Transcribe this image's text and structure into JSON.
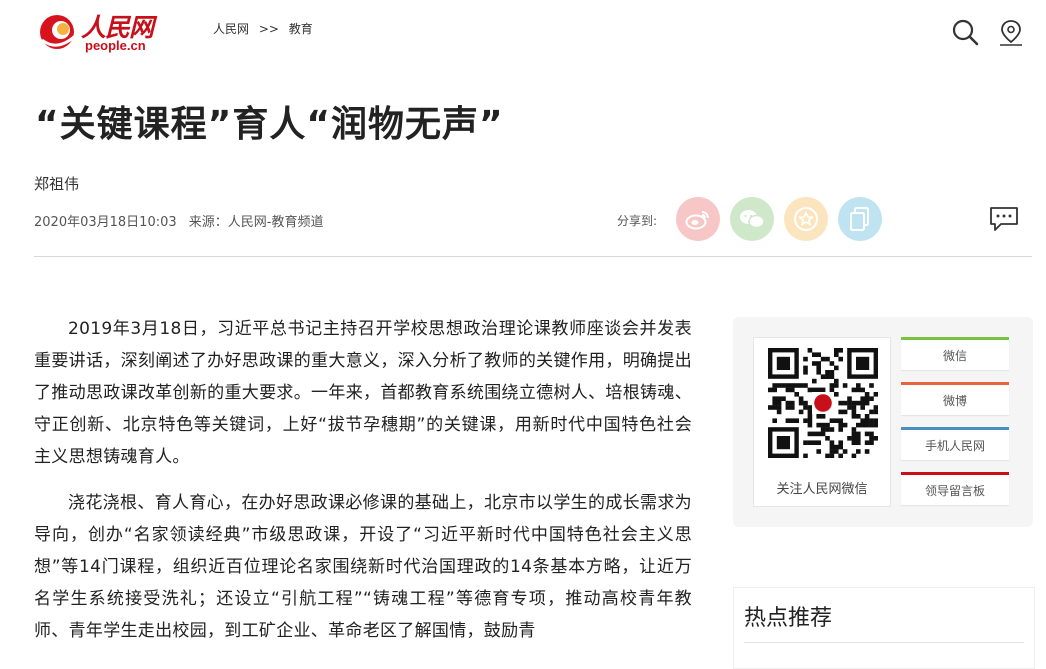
{
  "header": {
    "logo_cn": "人民网",
    "logo_en": "people.cn",
    "breadcrumb": [
      "人民网",
      ">>",
      "教育"
    ]
  },
  "article": {
    "title": "“关键课程”育人“润物无声”",
    "author": "郑祖伟",
    "datetime": "2020年03月18日10:03",
    "source": "来源：人民网-教育频道",
    "share_label": "分享到:",
    "paragraphs": [
      "2019年3月18日，习近平总书记主持召开学校思想政治理论课教师座谈会并发表重要讲话，深刻阐述了办好思政课的重大意义，深入分析了教师的关键作用，明确提出了推动思政课改革创新的重大要求。一年来，首都教育系统围绕立德树人、培根铸魂、守正创新、北京特色等关键词，上好“拔节孕穗期”的关键课，用新时代中国特色社会主义思想铸魂育人。",
      "浇花浇根、育人育心，在办好思政课必修课的基础上，北京市以学生的成长需求为导向，创办“名家领读经典”市级思政课，开设了“习近平新时代中国特色社会主义思想”等14门课程，组织近百位理论名家围绕新时代治国理政的14条基本方略，让近万名学生系统接受洗礼；还设立“引航工程”“铸魂工程”等德育专项，推动高校青年教师、青年学生走出校园，到工矿企业、革命老区了解国情，鼓励青"
    ]
  },
  "share": [
    {
      "name": "weibo",
      "color": "#f7c6c6"
    },
    {
      "name": "wechat",
      "color": "#cfe8c9"
    },
    {
      "name": "favorite",
      "color": "#fbe5bf"
    },
    {
      "name": "copy",
      "color": "#bfe3f1"
    }
  ],
  "sidebar": {
    "qr_label": "关注人民网微信",
    "links": [
      {
        "label": "微信",
        "color": "#7cc242"
      },
      {
        "label": "微博",
        "color": "#e8643c"
      },
      {
        "label": "手机人民网",
        "color": "#4a8fc1"
      },
      {
        "label": "领导留言板",
        "color": "#c8101a"
      }
    ],
    "hot_title": "热点推荐"
  },
  "colors": {
    "brand": "#c8101a"
  }
}
